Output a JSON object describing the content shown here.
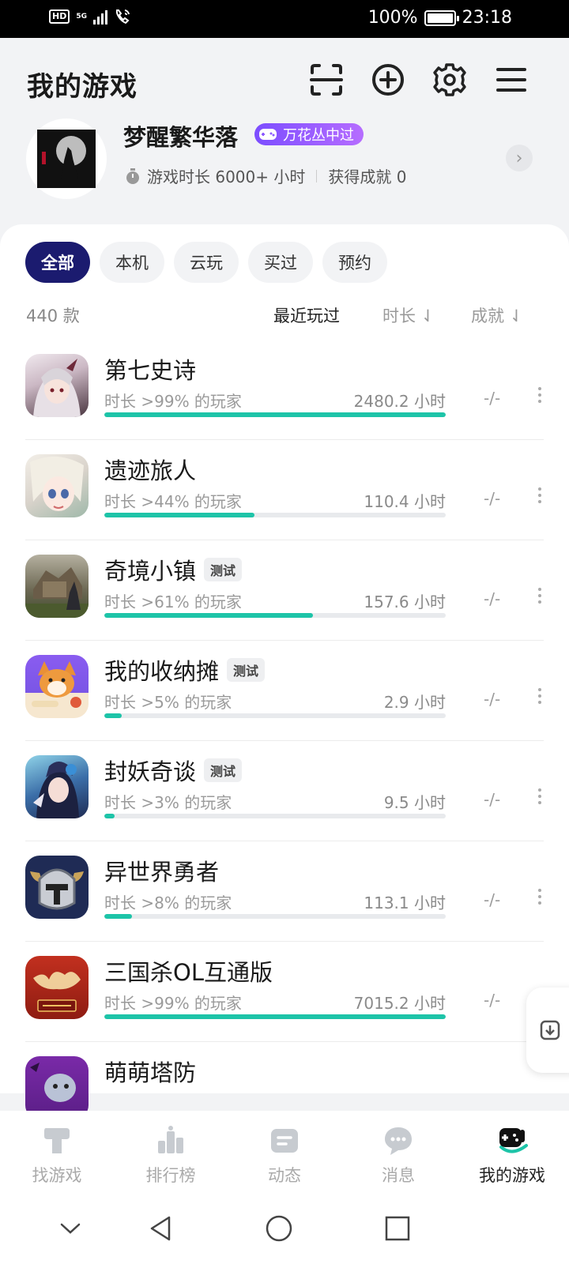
{
  "status_bar": {
    "hd": "HD",
    "network": "5G",
    "battery": "100%",
    "time": "23:18"
  },
  "header": {
    "title": "我的游戏"
  },
  "profile": {
    "username": "梦醒繁华落",
    "badge": "万花丛中过",
    "playtime": "游戏时长 6000+ 小时",
    "achievements": "获得成就 0"
  },
  "filters": [
    "全部",
    "本机",
    "云玩",
    "买过",
    "预约"
  ],
  "list": {
    "count": "440 款",
    "sort_recent": "最近玩过",
    "sort_duration": "时长 ⇃",
    "sort_achievement": "成就 ⇃"
  },
  "games": [
    {
      "name": "第七史诗",
      "tag": "",
      "percentile": "时长 >99% 的玩家",
      "hours": "2480.2 小时",
      "achievement": "-/-",
      "progress": 1.0
    },
    {
      "name": "遗迹旅人",
      "tag": "",
      "percentile": "时长 >44% 的玩家",
      "hours": "110.4 小时",
      "achievement": "-/-",
      "progress": 0.44
    },
    {
      "name": "奇境小镇",
      "tag": "测试",
      "percentile": "时长 >61% 的玩家",
      "hours": "157.6 小时",
      "achievement": "-/-",
      "progress": 0.61
    },
    {
      "name": "我的收纳摊",
      "tag": "测试",
      "percentile": "时长 >5% 的玩家",
      "hours": "2.9 小时",
      "achievement": "-/-",
      "progress": 0.05
    },
    {
      "name": "封妖奇谈",
      "tag": "测试",
      "percentile": "时长 >3% 的玩家",
      "hours": "9.5 小时",
      "achievement": "-/-",
      "progress": 0.03
    },
    {
      "name": "异世界勇者",
      "tag": "",
      "percentile": "时长 >8% 的玩家",
      "hours": "113.1 小时",
      "achievement": "-/-",
      "progress": 0.08
    },
    {
      "name": "三国杀OL互通版",
      "tag": "",
      "percentile": "时长 >99% 的玩家",
      "hours": "7015.2 小时",
      "achievement": "-/-",
      "progress": 1.0
    },
    {
      "name": "萌萌塔防",
      "tag": "",
      "percentile": "",
      "hours": "",
      "achievement": "",
      "progress": 0
    }
  ],
  "nav": [
    "找游戏",
    "排行榜",
    "动态",
    "消息",
    "我的游戏"
  ],
  "colors": {
    "accent": "#1dc4a8",
    "chip_active": "#1b1b6f",
    "badge": "#8e5cff"
  }
}
